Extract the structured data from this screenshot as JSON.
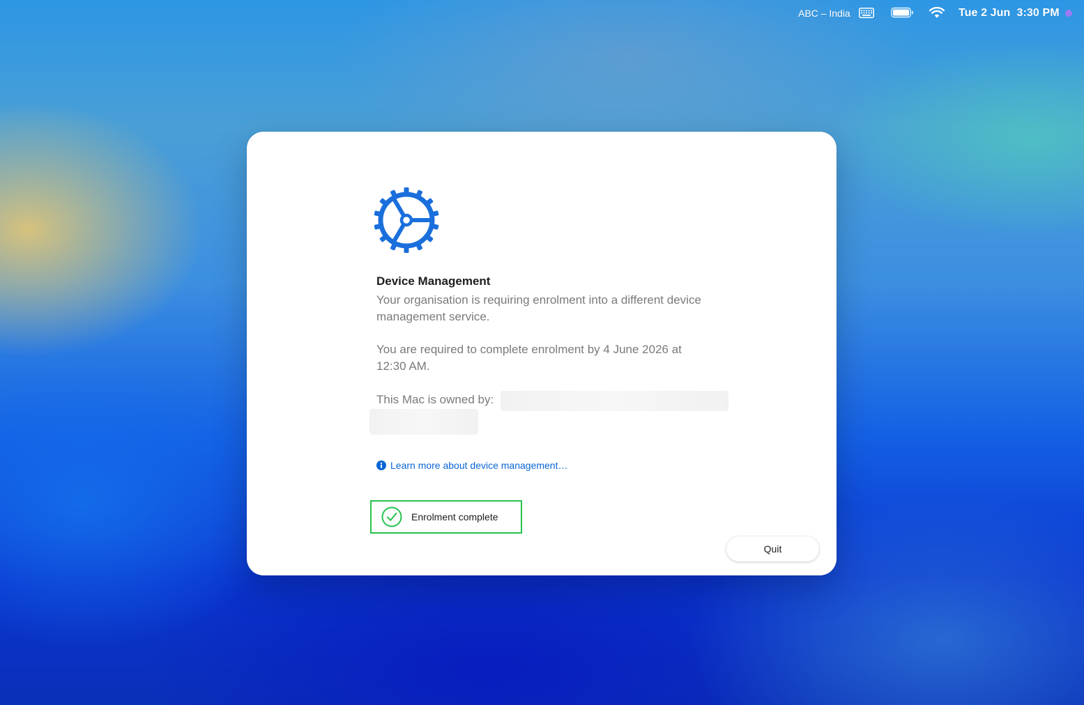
{
  "menubar": {
    "input_source": "ABC – India",
    "clock": "Tue 2 Jun  3:30 PM",
    "icons": [
      "keyboard-icon",
      "battery-icon",
      "wifi-icon",
      "status-dot"
    ]
  },
  "dialog": {
    "icon": "gear-icon",
    "title": "Device Management",
    "paragraph1": "Your organisation is requiring enrolment into a different device management service.",
    "paragraph2": "You are required to complete enrolment by 4 June 2026 at 12:30 AM.",
    "owner_label": "This Mac is owned by:",
    "learn_more": "Learn more about device management…",
    "status": "Enrolment complete",
    "quit_label": "Quit"
  },
  "colors": {
    "accent": "#1a6fdc",
    "link": "#0a66d4",
    "success": "#27c24c",
    "status_dot": "#9b7cf2"
  }
}
